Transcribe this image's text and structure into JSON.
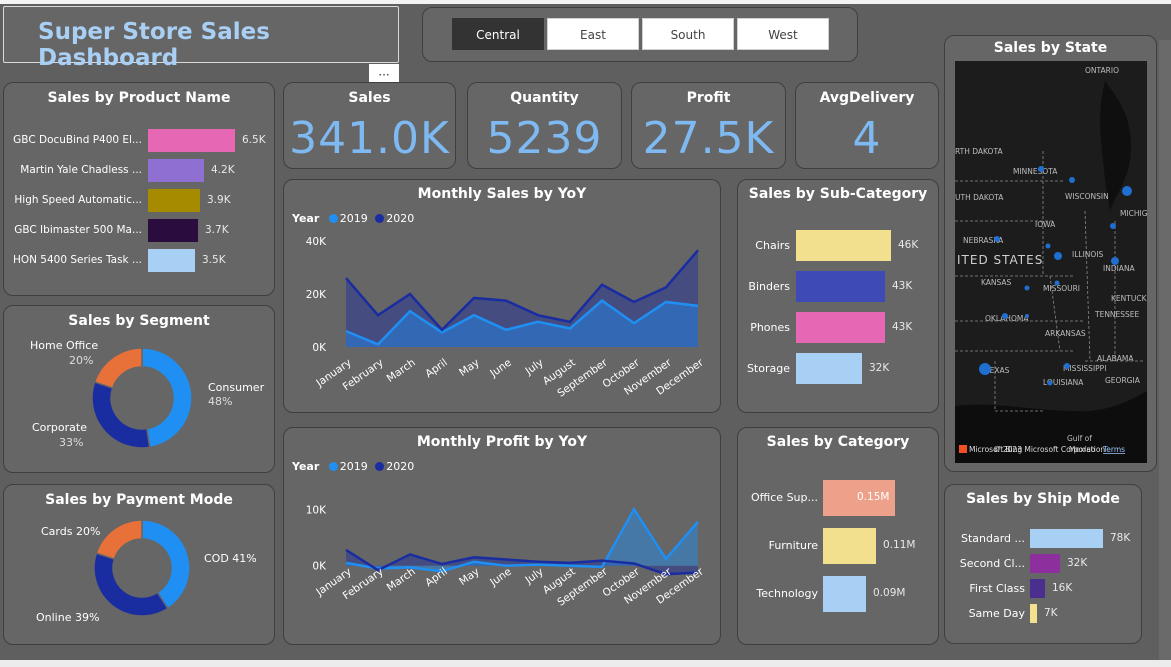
{
  "title": "Super Store Sales Dashboard",
  "slicer": {
    "buttons": [
      "Central",
      "East",
      "South",
      "West"
    ],
    "active": "Central"
  },
  "kpis": {
    "sales": {
      "label": "Sales",
      "value": "341.0K"
    },
    "quantity": {
      "label": "Quantity",
      "value": "5239"
    },
    "profit": {
      "label": "Profit",
      "value": "27.5K"
    },
    "delivery": {
      "label": "AvgDelivery",
      "value": "4"
    }
  },
  "product": {
    "title": "Sales by Product Name",
    "items": [
      {
        "name": "GBC DocuBind P400 El...",
        "label": "6.5K",
        "value": 6.5,
        "color": "#e667b4"
      },
      {
        "name": "Martin Yale Chadless ...",
        "label": "4.2K",
        "value": 4.2,
        "color": "#8f6fd1"
      },
      {
        "name": "High Speed Automatic...",
        "label": "3.9K",
        "value": 3.9,
        "color": "#a68a00"
      },
      {
        "name": "GBC Ibimaster 500 Ma...",
        "label": "3.7K",
        "value": 3.7,
        "color": "#2a0c3e"
      },
      {
        "name": "HON 5400 Series Task ...",
        "label": "3.5K",
        "value": 3.5,
        "color": "#a8d0f5"
      }
    ]
  },
  "segment": {
    "title": "Sales by Segment",
    "items": [
      {
        "name": "Consumer",
        "pct": "48%",
        "value": 48,
        "color": "#1f8ff3"
      },
      {
        "name": "Corporate",
        "pct": "33%",
        "value": 33,
        "color": "#1a2da0"
      },
      {
        "name": "Home Office",
        "pct": "20%",
        "value": 20,
        "color": "#e8713a"
      }
    ]
  },
  "payment": {
    "title": "Sales by Payment Mode",
    "items": [
      {
        "name": "COD",
        "label": "COD 41%",
        "value": 41,
        "color": "#1f8ff3"
      },
      {
        "name": "Online",
        "label": "Online 39%",
        "value": 39,
        "color": "#1a2da0"
      },
      {
        "name": "Cards",
        "label": "Cards 20%",
        "value": 20,
        "color": "#e8713a"
      }
    ]
  },
  "monthly_sales": {
    "title": "Monthly Sales by YoY",
    "legend_title": "Year",
    "y_ticks": [
      "40K",
      "20K",
      "0K"
    ]
  },
  "monthly_profit": {
    "title": "Monthly Profit by YoY",
    "legend_title": "Year",
    "y_ticks": [
      "10K",
      "0K"
    ]
  },
  "subcategory": {
    "title": "Sales by Sub-Category",
    "items": [
      {
        "name": "Chairs",
        "label": "46K",
        "value": 46,
        "color": "#f2e08f"
      },
      {
        "name": "Binders",
        "label": "43K",
        "value": 43,
        "color": "#3e4ab5"
      },
      {
        "name": "Phones",
        "label": "43K",
        "value": 43,
        "color": "#e667b4"
      },
      {
        "name": "Storage",
        "label": "32K",
        "value": 32,
        "color": "#a8d0f5"
      }
    ]
  },
  "category": {
    "title": "Sales by Category",
    "items": [
      {
        "name": "Office Sup...",
        "label": "0.15M",
        "value": 0.15,
        "color": "#eda18a"
      },
      {
        "name": "Furniture",
        "label": "0.11M",
        "value": 0.11,
        "color": "#f2e08f"
      },
      {
        "name": "Technology",
        "label": "0.09M",
        "value": 0.09,
        "color": "#a8d0f5"
      }
    ]
  },
  "shipmode": {
    "title": "Sales by Ship Mode",
    "items": [
      {
        "name": "Standard ...",
        "label": "78K",
        "value": 78,
        "color": "#a8d0f5"
      },
      {
        "name": "Second Cl...",
        "label": "32K",
        "value": 32,
        "color": "#8e2f9e"
      },
      {
        "name": "First Class",
        "label": "16K",
        "value": 16,
        "color": "#4b2f8e"
      },
      {
        "name": "Same Day",
        "label": "7K",
        "value": 7,
        "color": "#f2e08f"
      }
    ]
  },
  "map": {
    "title": "Sales by State",
    "labels": [
      "ONTARIO",
      "RTH DAKOTA",
      "MINNESOTA",
      "UTH DAKOTA",
      "WISCONSIN",
      "MICHIG",
      "NEBRASKA",
      "IOWA",
      "ITED STATES",
      "ILLINOIS",
      "INDIANA",
      "KANSAS",
      "MISSOURI",
      "KENTUCK",
      "OKLAHOMA",
      "ARKANSAS",
      "TENNESSEE",
      "ALABAMA",
      "TEXAS",
      "MISSISSIPPI",
      "GEORGIA",
      "LOUISIANA",
      "Gulf of",
      "Mexico"
    ],
    "copyright": "© 2023 Microsoft Corporation",
    "terms": "Terms",
    "brand": "Microsoft Bing"
  },
  "chart_data": [
    {
      "type": "area",
      "title": "Monthly Sales by YoY",
      "x": [
        "January",
        "February",
        "March",
        "April",
        "May",
        "June",
        "July",
        "August",
        "September",
        "October",
        "November",
        "December"
      ],
      "ylim": [
        0,
        40000
      ],
      "series": [
        {
          "name": "2019",
          "color": "#1f8ff3",
          "values": [
            6000,
            1000,
            13500,
            5500,
            12000,
            6500,
            9500,
            7000,
            17500,
            9000,
            17000,
            15500
          ]
        },
        {
          "name": "2020",
          "color": "#1a2da0",
          "values": [
            26000,
            12000,
            20000,
            6500,
            18500,
            17500,
            12000,
            9500,
            23500,
            17000,
            22500,
            36500
          ]
        }
      ]
    },
    {
      "type": "area",
      "title": "Monthly Profit by YoY",
      "x": [
        "January",
        "February",
        "March",
        "April",
        "May",
        "June",
        "July",
        "August",
        "September",
        "October",
        "November",
        "December"
      ],
      "ylim": [
        -2000,
        12000
      ],
      "series": [
        {
          "name": "2019",
          "color": "#1f8ff3",
          "values": [
            500,
            -500,
            -300,
            -1000,
            700,
            0,
            200,
            0,
            -200,
            10000,
            1200,
            7800
          ]
        },
        {
          "name": "2020",
          "color": "#1a2da0",
          "values": [
            2800,
            -800,
            2000,
            300,
            1500,
            1100,
            700,
            500,
            900,
            400,
            -1500,
            -1200
          ]
        }
      ]
    }
  ]
}
